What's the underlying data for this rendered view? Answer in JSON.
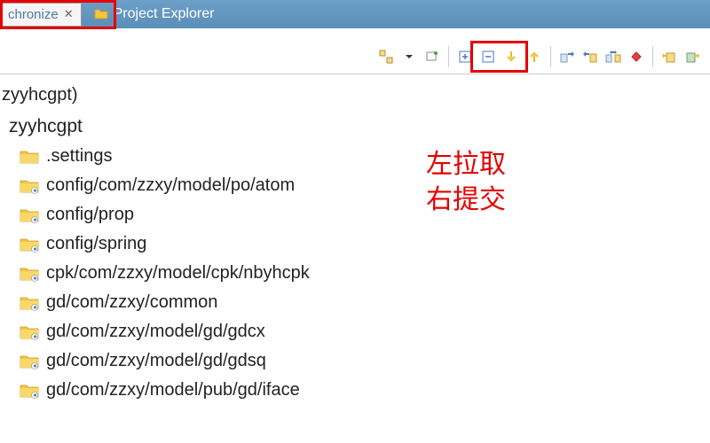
{
  "tabs": {
    "active": {
      "label": "chronize"
    },
    "inactive": {
      "label": "Project Explorer"
    }
  },
  "tree": {
    "root": "zyyhcgpt)",
    "project": "zyyhcgpt",
    "items": [
      ".settings",
      "config/com/zzxy/model/po/atom",
      "config/prop",
      "config/spring",
      "cpk/com/zzxy/model/cpk/nbyhcpk",
      "gd/com/zzxy/common",
      "gd/com/zzxy/model/gd/gdcx",
      "gd/com/zzxy/model/gd/gdsq",
      "gd/com/zzxy/model/pub/gd/iface"
    ]
  },
  "annotations": {
    "line1": "左拉取",
    "line2": "右提交"
  },
  "icons": {
    "folder": "folder-icon",
    "sync_folder": "sync-folder-icon"
  }
}
